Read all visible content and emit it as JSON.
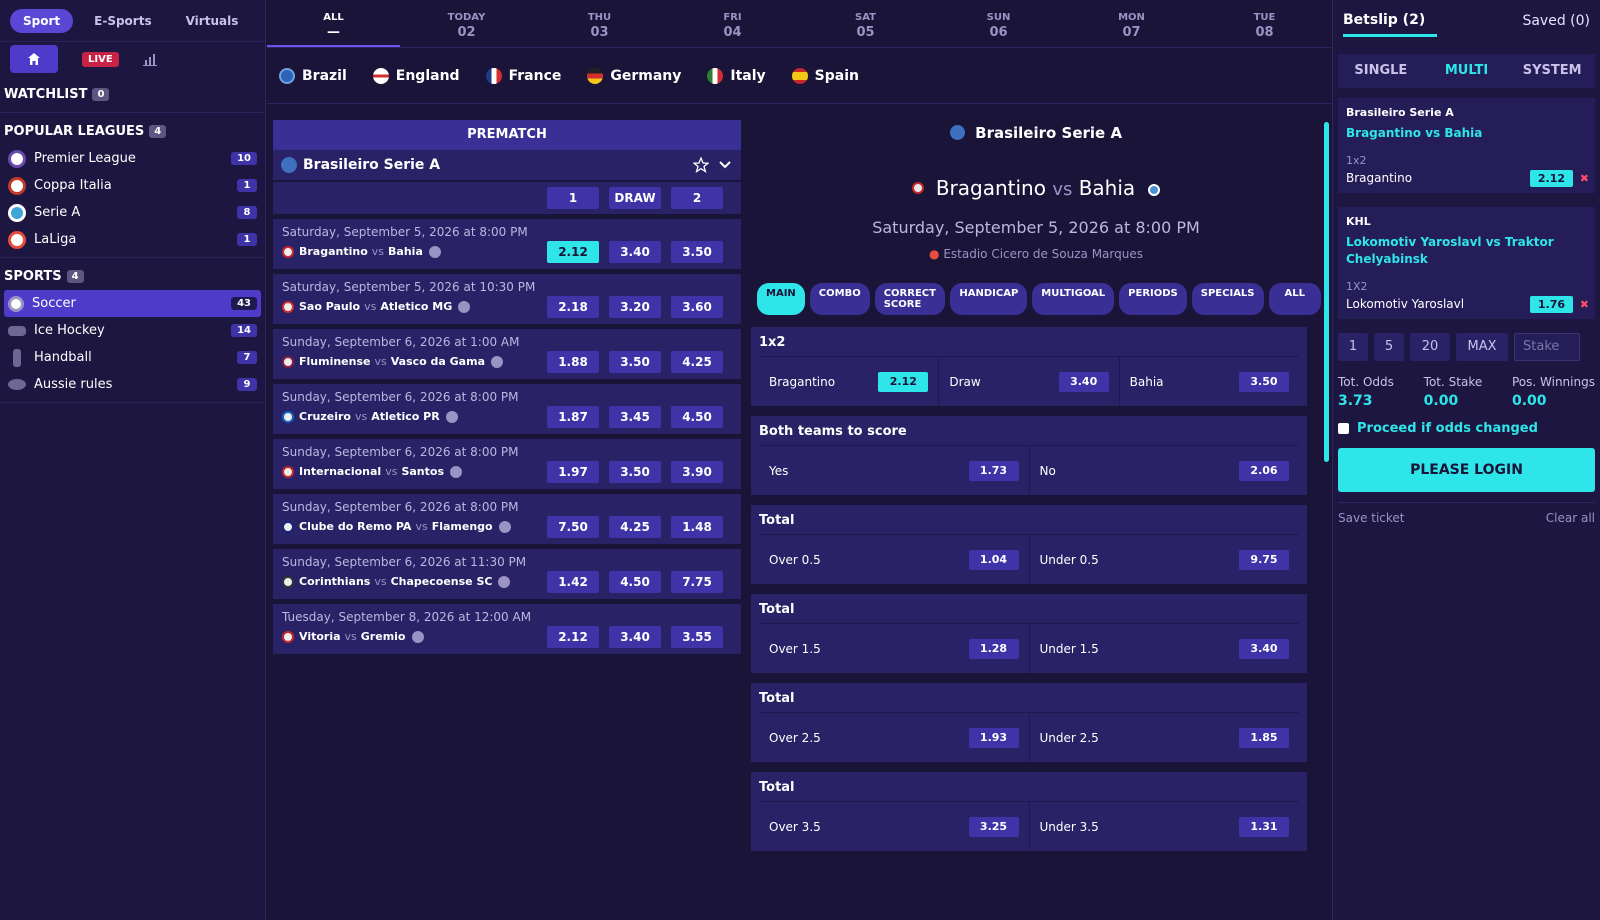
{
  "nav": {
    "tabs": [
      "Sport",
      "E-Sports",
      "Virtuals"
    ],
    "live": "LIVE"
  },
  "watchlist": {
    "label": "WATCHLIST",
    "count": "0"
  },
  "popular": {
    "label": "POPULAR LEAGUES",
    "count": "4",
    "items": [
      {
        "name": "Premier League",
        "count": "10"
      },
      {
        "name": "Coppa Italia",
        "count": "1"
      },
      {
        "name": "Serie A",
        "count": "8"
      },
      {
        "name": "LaLiga",
        "count": "1"
      }
    ]
  },
  "sports": {
    "label": "SPORTS",
    "count": "4",
    "items": [
      {
        "name": "Soccer",
        "count": "43"
      },
      {
        "name": "Ice Hockey",
        "count": "14"
      },
      {
        "name": "Handball",
        "count": "7"
      },
      {
        "name": "Aussie rules",
        "count": "9"
      }
    ]
  },
  "dates": [
    {
      "d": "ALL",
      "n": "—"
    },
    {
      "d": "TODAY",
      "n": "02"
    },
    {
      "d": "THU",
      "n": "03"
    },
    {
      "d": "FRI",
      "n": "04"
    },
    {
      "d": "SAT",
      "n": "05"
    },
    {
      "d": "SUN",
      "n": "06"
    },
    {
      "d": "MON",
      "n": "07"
    },
    {
      "d": "TUE",
      "n": "08"
    }
  ],
  "countries": [
    "Brazil",
    "England",
    "France",
    "Germany",
    "Italy",
    "Spain"
  ],
  "prematch": {
    "title": "PREMATCH",
    "league": "Brasileiro Serie A",
    "cols": [
      "1",
      "DRAW",
      "2"
    ],
    "matches": [
      {
        "when": "Saturday, September 5, 2026 at 8:00 PM",
        "home": "Bragantino",
        "away": "Bahia",
        "o": [
          "2.12",
          "3.40",
          "3.50"
        ]
      },
      {
        "when": "Saturday, September 5, 2026 at 10:30 PM",
        "home": "Sao Paulo",
        "away": "Atletico MG",
        "o": [
          "2.18",
          "3.20",
          "3.60"
        ]
      },
      {
        "when": "Sunday, September 6, 2026 at 1:00 AM",
        "home": "Fluminense",
        "away": "Vasco da Gama",
        "o": [
          "1.88",
          "3.50",
          "4.25"
        ]
      },
      {
        "when": "Sunday, September 6, 2026 at 8:00 PM",
        "home": "Cruzeiro",
        "away": "Atletico PR",
        "o": [
          "1.87",
          "3.45",
          "4.50"
        ]
      },
      {
        "when": "Sunday, September 6, 2026 at 8:00 PM",
        "home": "Internacional",
        "away": "Santos",
        "o": [
          "1.97",
          "3.50",
          "3.90"
        ]
      },
      {
        "when": "Sunday, September 6, 2026 at 8:00 PM",
        "home": "Clube do Remo PA",
        "away": "Flamengo",
        "o": [
          "7.50",
          "4.25",
          "1.48"
        ]
      },
      {
        "when": "Sunday, September 6, 2026 at 11:30 PM",
        "home": "Corinthians",
        "away": "Chapecoense SC",
        "o": [
          "1.42",
          "4.50",
          "7.75"
        ]
      },
      {
        "when": "Tuesday, September 8, 2026 at 12:00 AM",
        "home": "Vitoria",
        "away": "Gremio",
        "o": [
          "2.12",
          "3.40",
          "3.55"
        ]
      }
    ]
  },
  "event": {
    "league": "Brasileiro Serie A",
    "home": "Bragantino",
    "vs": "vs",
    "away": "Bahia",
    "date": "Saturday, September 5, 2026 at 8:00 PM",
    "venue": "Estadio Cicero de Souza Marques",
    "tabs": [
      "MAIN",
      "COMBO",
      "CORRECT SCORE",
      "HANDICAP",
      "MULTIGOAL",
      "PERIODS",
      "SPECIALS",
      "ALL"
    ],
    "markets": [
      {
        "title": "1x2",
        "cells": [
          {
            "l": "Bragantino",
            "o": "2.12"
          },
          {
            "l": "Draw",
            "o": "3.40"
          },
          {
            "l": "Bahia",
            "o": "3.50"
          }
        ]
      },
      {
        "title": "Both teams to score",
        "cells": [
          {
            "l": "Yes",
            "o": "1.73"
          },
          {
            "l": "No",
            "o": "2.06"
          }
        ]
      },
      {
        "title": "Total",
        "cells": [
          {
            "l": "Over 0.5",
            "o": "1.04"
          },
          {
            "l": "Under 0.5",
            "o": "9.75"
          }
        ]
      },
      {
        "title": "Total",
        "cells": [
          {
            "l": "Over 1.5",
            "o": "1.28"
          },
          {
            "l": "Under 1.5",
            "o": "3.40"
          }
        ]
      },
      {
        "title": "Total",
        "cells": [
          {
            "l": "Over 2.5",
            "o": "1.93"
          },
          {
            "l": "Under 2.5",
            "o": "1.85"
          }
        ]
      },
      {
        "title": "Total",
        "cells": [
          {
            "l": "Over 3.5",
            "o": "3.25"
          },
          {
            "l": "Under 3.5",
            "o": "1.31"
          }
        ]
      }
    ]
  },
  "betslip": {
    "title": "Betslip (2)",
    "saved": "Saved (0)",
    "tabs": [
      "SINGLE",
      "MULTI",
      "SYSTEM"
    ],
    "bets": [
      {
        "league": "Brasileiro Serie A",
        "match": "Bragantino vs Bahia",
        "market": "1x2",
        "pick": "Bragantino",
        "odd": "2.12"
      },
      {
        "league": "KHL",
        "match": "Lokomotiv Yaroslavl vs Traktor Chelyabinsk",
        "market": "1X2",
        "pick": "Lokomotiv Yaroslavl",
        "odd": "1.76"
      }
    ],
    "stakes": [
      "1",
      "5",
      "20",
      "MAX"
    ],
    "stake_placeholder": "Stake",
    "tot_odds_label": "Tot. Odds",
    "tot_odds": "3.73",
    "tot_stake_label": "Tot. Stake",
    "tot_stake": "0.00",
    "win_label": "Pos. Winnings",
    "win": "0.00",
    "proceed": "Proceed if odds changed",
    "login": "PLEASE LOGIN",
    "save": "Save ticket",
    "clear": "Clear all"
  }
}
